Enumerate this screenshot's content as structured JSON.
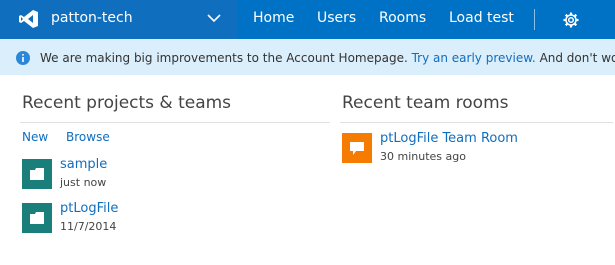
{
  "header": {
    "account_name": "patton-tech",
    "nav": [
      {
        "label": "Home"
      },
      {
        "label": "Users"
      },
      {
        "label": "Rooms"
      },
      {
        "label": "Load test"
      }
    ],
    "colors": {
      "bar": "#0072c6",
      "account": "#106ebe"
    }
  },
  "banner": {
    "text_before": "We are making big improvements to the Account Homepage.",
    "link": "Try an early preview.",
    "text_after": "And don't worry, you can"
  },
  "projects": {
    "title": "Recent projects & teams",
    "links": [
      "New",
      "Browse"
    ],
    "items": [
      {
        "name": "sample",
        "date": "just now"
      },
      {
        "name": "ptLogFile",
        "date": "11/7/2014"
      }
    ]
  },
  "rooms": {
    "title": "Recent team rooms",
    "items": [
      {
        "name": "ptLogFile Team Room",
        "date": "30 minutes ago"
      }
    ]
  }
}
